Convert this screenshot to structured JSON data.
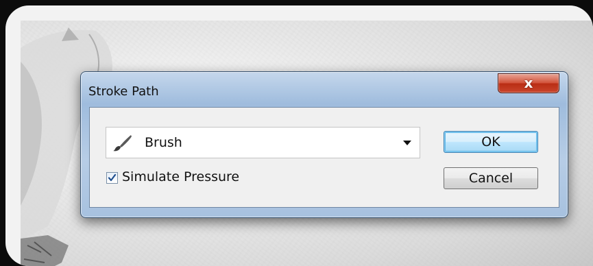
{
  "dialog": {
    "title": "Stroke Path",
    "close_label": "x",
    "tool": {
      "icon": "brush-icon",
      "value": "Brush"
    },
    "simulate_pressure": {
      "label": "Simulate Pressure",
      "checked": true
    },
    "ok_label": "OK",
    "cancel_label": "Cancel"
  },
  "colors": {
    "titlebar": "#a9c4e3",
    "close_button": "#c9452c",
    "ok_focus": "#5fb6e6"
  }
}
